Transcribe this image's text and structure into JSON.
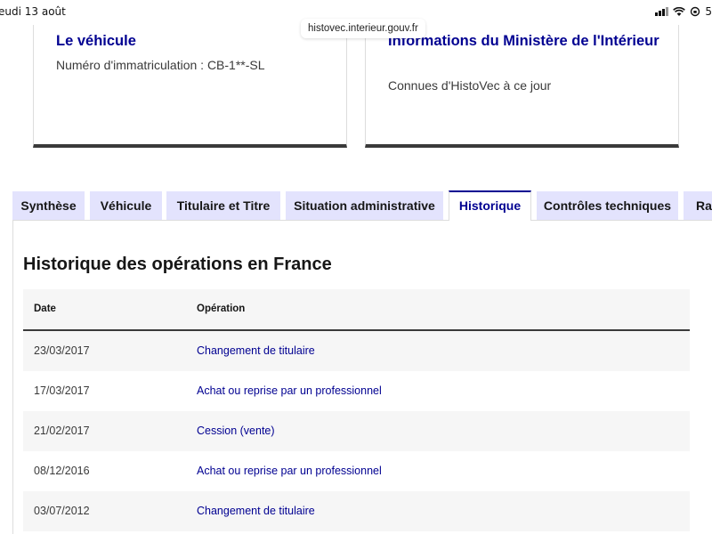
{
  "status_bar": {
    "time": "eudi 13 août",
    "battery": "5",
    "icons": [
      "signal-icon",
      "wifi-icon",
      "orientation-lock-icon"
    ]
  },
  "browser": {
    "url": "histovec.interieur.gouv.fr"
  },
  "cards": [
    {
      "title": "Le véhicule",
      "description": "Numéro d'immatriculation : CB-1**-SL"
    },
    {
      "title": "Informations du Ministère de l'Intérieur",
      "description": "Connues d'HistoVec à ce jour"
    }
  ],
  "tabs": [
    {
      "label": "Synthèse",
      "active": false
    },
    {
      "label": "Véhicule",
      "active": false
    },
    {
      "label": "Titulaire et Titre",
      "active": false
    },
    {
      "label": "Situation administrative",
      "active": false
    },
    {
      "label": "Historique",
      "active": true
    },
    {
      "label": "Contrôles techniques",
      "active": false
    },
    {
      "label": "Rap",
      "active": false
    }
  ],
  "history": {
    "title": "Historique des opérations en France",
    "columns": [
      "Date",
      "Opération"
    ],
    "rows": [
      {
        "date": "23/03/2017",
        "operation": "Changement de titulaire"
      },
      {
        "date": "17/03/2017",
        "operation": "Achat ou reprise par un professionnel"
      },
      {
        "date": "21/02/2017",
        "operation": "Cession (vente)"
      },
      {
        "date": "08/12/2016",
        "operation": "Achat ou reprise par un professionnel"
      },
      {
        "date": "03/07/2012",
        "operation": "Changement de titulaire"
      }
    ]
  },
  "colors": {
    "accent": "#000091",
    "tab_background": "#e3e3fd",
    "row_alt": "#f6f6f6"
  }
}
